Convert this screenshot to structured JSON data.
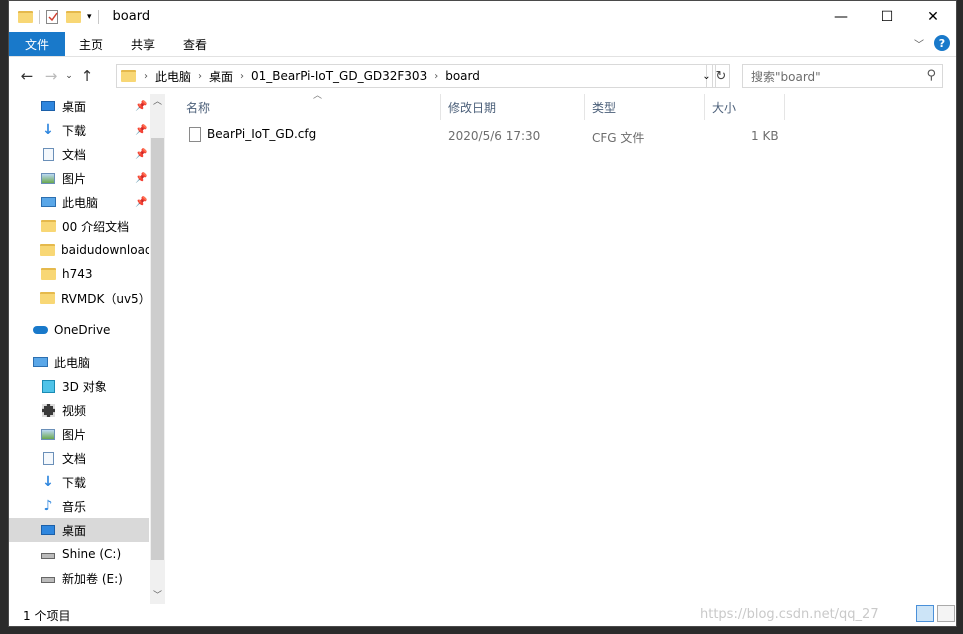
{
  "window": {
    "title": "board",
    "controls": {
      "minimize": "—",
      "maximize": "☐",
      "close": "✕"
    }
  },
  "ribbon": {
    "tabs": [
      "文件",
      "主页",
      "共享",
      "查看"
    ],
    "help": "?"
  },
  "address": {
    "crumbs": [
      "此电脑",
      "桌面",
      "01_BearPi-IoT_GD_GD32F303",
      "board"
    ]
  },
  "search": {
    "placeholder": "搜索\"board\""
  },
  "nav": {
    "quick_access": [
      {
        "label": "桌面",
        "icon": "desktop-icon",
        "pinned": true
      },
      {
        "label": "下载",
        "icon": "download-icon",
        "pinned": true
      },
      {
        "label": "文档",
        "icon": "document-icon",
        "pinned": true
      },
      {
        "label": "图片",
        "icon": "pictures-icon",
        "pinned": true
      },
      {
        "label": "此电脑",
        "icon": "pc-icon",
        "pinned": true
      },
      {
        "label": "00 介绍文档",
        "icon": "folder-icon",
        "pinned": false
      },
      {
        "label": "baidudownload",
        "icon": "folder-icon",
        "pinned": false
      },
      {
        "label": "h743",
        "icon": "folder-icon",
        "pinned": false
      },
      {
        "label": "RVMDK（uv5）",
        "icon": "folder-icon",
        "pinned": false
      }
    ],
    "onedrive": "OneDrive",
    "this_pc": "此电脑",
    "pc_items": [
      {
        "label": "3D 对象",
        "icon": "3d-objects-icon"
      },
      {
        "label": "视频",
        "icon": "video-icon"
      },
      {
        "label": "图片",
        "icon": "pictures-icon"
      },
      {
        "label": "文档",
        "icon": "document-icon"
      },
      {
        "label": "下载",
        "icon": "download-icon"
      },
      {
        "label": "音乐",
        "icon": "music-icon"
      },
      {
        "label": "桌面",
        "icon": "desktop-icon",
        "selected": true
      },
      {
        "label": "Shine (C:)",
        "icon": "drive-icon"
      },
      {
        "label": "新加卷 (E:)",
        "icon": "drive-icon"
      }
    ]
  },
  "columns": [
    "名称",
    "修改日期",
    "类型",
    "大小"
  ],
  "files": [
    {
      "name": "BearPi_IoT_GD.cfg",
      "modified": "2020/5/6 17:30",
      "type": "CFG 文件",
      "size": "1 KB"
    }
  ],
  "status": {
    "count": "1 个项目"
  },
  "watermark": "https://blog.csdn.net/qq_27"
}
